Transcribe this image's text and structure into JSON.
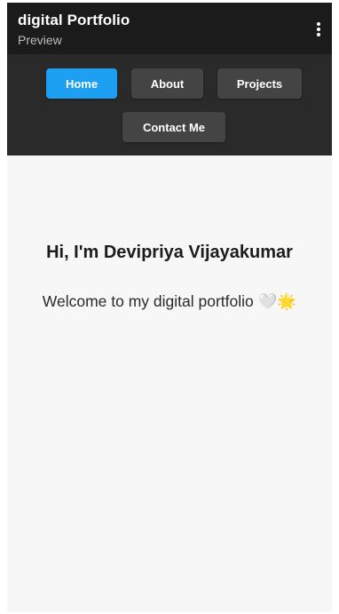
{
  "app_bar": {
    "title": "digital Portfolio",
    "subtitle": "Preview",
    "menu_icon": "more-vert-icon"
  },
  "nav": {
    "active_color": "#1ea0f2",
    "items": [
      {
        "label": "Home",
        "active": true
      },
      {
        "label": "About",
        "active": false
      },
      {
        "label": "Projects",
        "active": false
      },
      {
        "label": "Contact Me",
        "active": false
      }
    ]
  },
  "hero": {
    "title": "Hi, I'm Devipriya Vijayakumar",
    "subtitle": "Welcome to my digital portfolio 🤍🌟"
  }
}
